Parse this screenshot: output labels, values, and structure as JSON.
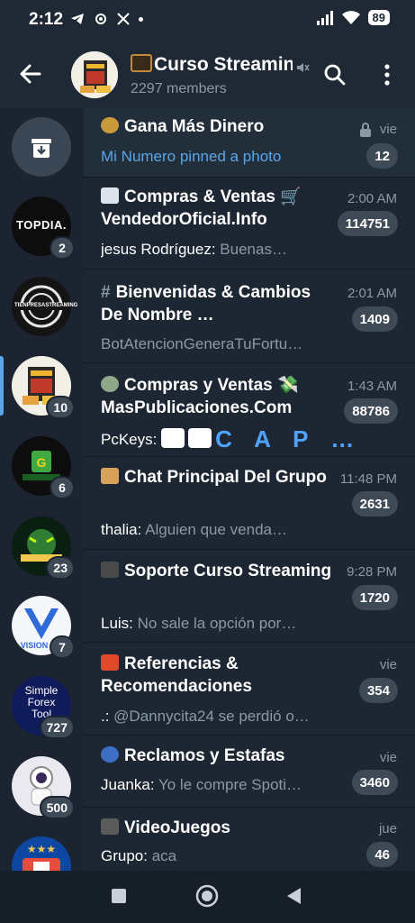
{
  "status_bar": {
    "time": "2:12",
    "battery": "89"
  },
  "header": {
    "title": "Curso Streamin",
    "subtitle": "2297 members"
  },
  "sidebar": {
    "items": [
      {
        "name": "archive",
        "badge": ""
      },
      {
        "name": "TOPDIA",
        "badge": "2",
        "logo_text": "TOPDIA."
      },
      {
        "name": "TIENPRESASTREAMING",
        "badge": "",
        "logo_text": "TIENPRESASTREAMING"
      },
      {
        "name": "curso-streaming",
        "badge": "10"
      },
      {
        "name": "generador",
        "badge": "6"
      },
      {
        "name": "forex",
        "badge": "23"
      },
      {
        "name": "vision-digital",
        "badge": "7",
        "logo_text": "VISION"
      },
      {
        "name": "simple-forex",
        "badge": "727",
        "logo_text": "Simple Forex Tool"
      },
      {
        "name": "astronaut",
        "badge": "500"
      },
      {
        "name": "stars",
        "badge": ""
      }
    ]
  },
  "topics": [
    {
      "title": "Gana Más Dinero",
      "message": "Mi Numero pinned a photo",
      "time": "vie",
      "badge": "12"
    },
    {
      "title": "Compras & Ventas 🛒 VendedorOficial.Info",
      "sender": "jesus Rodríguez: ",
      "message": "Buenas…",
      "time": "2:00 AM",
      "badge": "114751"
    },
    {
      "title": "Bienvenidas & Cambios De Nombre …",
      "sender": "",
      "message": "BotAtencionGeneraTuFortu…",
      "time": "2:01 AM",
      "badge": "1409"
    },
    {
      "title": "Compras y Ventas 💸 MasPublicaciones.Com",
      "sender": "PcKeys: ",
      "message": "C A P …",
      "time": "1:43 AM",
      "badge": "88786"
    },
    {
      "title": "Chat Principal Del Grupo",
      "sender": "thalia: ",
      "message": "Alguien que venda…",
      "time": "11:48 PM",
      "badge": "2631"
    },
    {
      "title": "Soporte Curso Streaming",
      "sender": "Luis: ",
      "message": "No sale la opción por…",
      "time": "9:28 PM",
      "badge": "1720"
    },
    {
      "title": "Referencias & Recomendaciones",
      "sender": ".: ",
      "message": "@Dannycita24 se perdió o…",
      "time": "vie",
      "badge": "354"
    },
    {
      "title": "Reclamos y Estafas",
      "sender": "Juanka: ",
      "message": "Yo le compre Spoti…",
      "time": "vie",
      "badge": "3460"
    },
    {
      "title": "VideoJuegos",
      "sender": "Grupo: ",
      "message": "aca",
      "time": "jue",
      "badge": "46"
    }
  ],
  "icons": {
    "row_icons": [
      "money-bag-icon",
      "card-icon",
      "hash-icon",
      "dollar-bill-icon",
      "house-icon",
      "graduation-cap-icon",
      "n1-icon",
      "police-icon",
      "gamepad-icon"
    ]
  },
  "colors": {
    "accent": "#5aa5ea",
    "background": "#1d2733",
    "header": "#1e2935",
    "badge": "#3e4a56"
  }
}
